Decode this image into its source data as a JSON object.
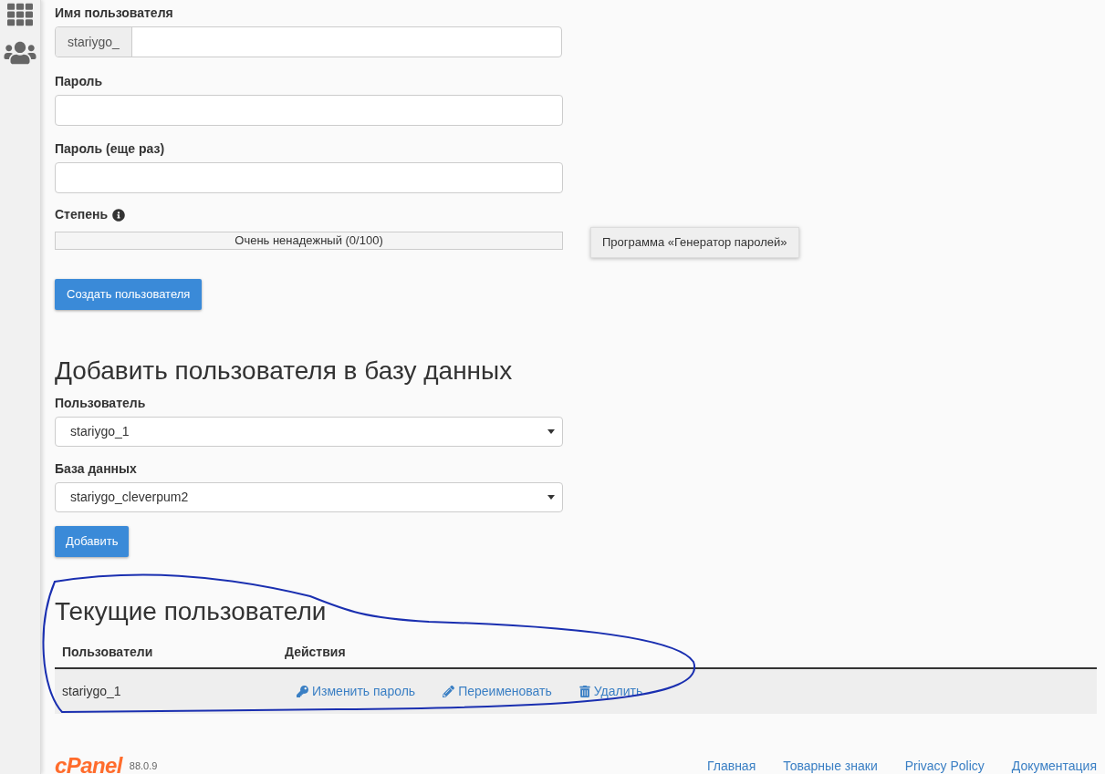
{
  "create_user": {
    "username": {
      "label": "Имя пользователя",
      "prefix": "stariygo_"
    },
    "password": {
      "label": "Пароль"
    },
    "password_again": {
      "label": "Пароль (еще раз)"
    },
    "strength": {
      "label": "Степень",
      "level": 0,
      "reading": "Очень ненадежный (0/100)"
    },
    "generator_button": "Программа «Генератор паролей»",
    "submit_button": "Создать пользователя"
  },
  "add_user_to_db": {
    "title": "Добавить пользователя в базу данных",
    "user": {
      "label": "Пользователь",
      "value": "stariygo_1"
    },
    "database": {
      "label": "База данных",
      "value": "stariygo_cleverpum2"
    },
    "submit_button": "Добавить"
  },
  "current_users": {
    "title": "Текущие пользователи",
    "columns": [
      "Пользователи",
      "Действия"
    ],
    "rows": [
      {
        "user": "stariygo_1",
        "actions": [
          {
            "kind": "key",
            "label": "Изменить пароль"
          },
          {
            "kind": "pencil",
            "label": "Переименовать"
          },
          {
            "kind": "trash",
            "label": "Удалить"
          }
        ]
      }
    ]
  },
  "footer": {
    "logo": "cPanel",
    "version": "88.0.9",
    "links": [
      "Главная",
      "Товарные знаки",
      "Privacy Policy",
      "Документация"
    ]
  }
}
